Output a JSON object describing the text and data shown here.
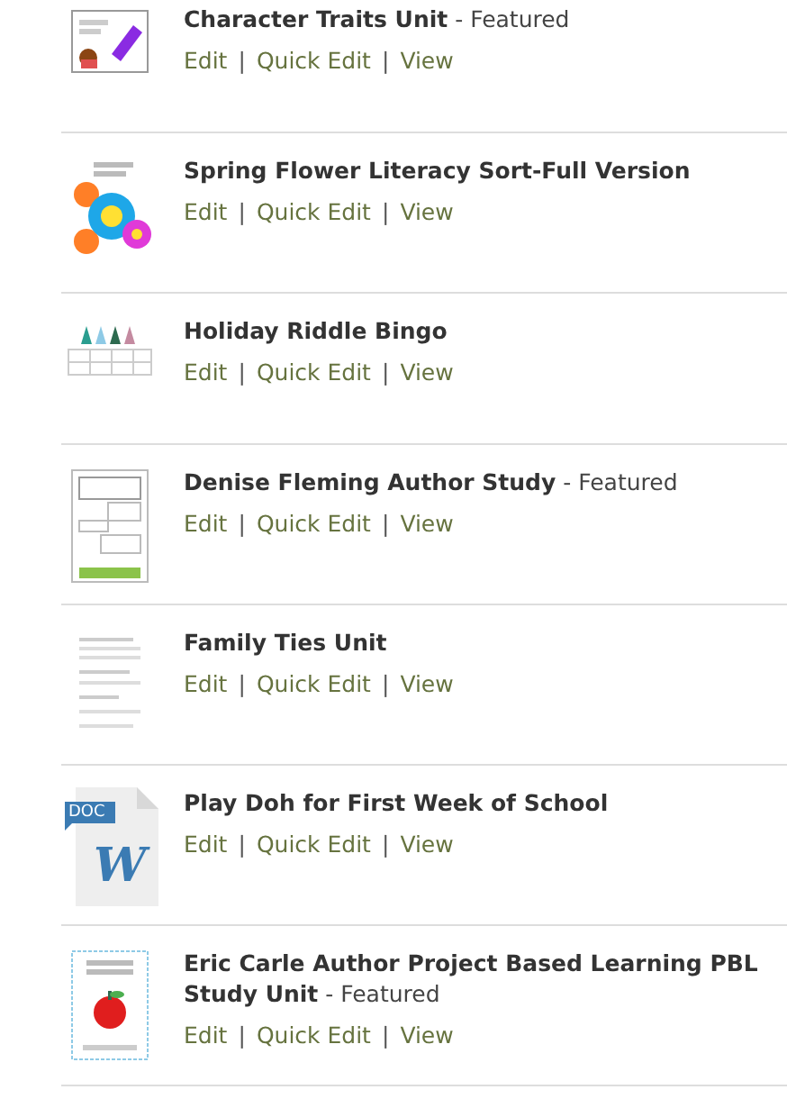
{
  "link_separator": "|",
  "items": [
    {
      "title": "Character Traits Unit",
      "featured_label": "- Featured",
      "links": [
        "Edit",
        "Quick Edit",
        "View"
      ]
    },
    {
      "title": "Spring Flower Literacy Sort-Full Version",
      "links": [
        "Edit",
        "Quick Edit",
        "View"
      ]
    },
    {
      "title": "Holiday Riddle Bingo",
      "links": [
        "Edit",
        "Quick Edit",
        "View"
      ]
    },
    {
      "title": "Denise Fleming Author Study",
      "featured_label": "- Featured",
      "links": [
        "Edit",
        "Quick Edit",
        "View"
      ]
    },
    {
      "title": "Family Ties Unit",
      "links": [
        "Edit",
        "Quick Edit",
        "View"
      ]
    },
    {
      "title": "Play Doh for First Week of School",
      "thumbnail": {
        "kind": "doc",
        "tag": "DOC",
        "letter": "W"
      },
      "links": [
        "Edit",
        "Quick Edit",
        "View"
      ]
    },
    {
      "title": "Eric Carle Author Project Based Learning PBL Study Unit",
      "featured_label": "- Featured",
      "links": [
        "Edit",
        "Quick Edit",
        "View"
      ]
    }
  ]
}
